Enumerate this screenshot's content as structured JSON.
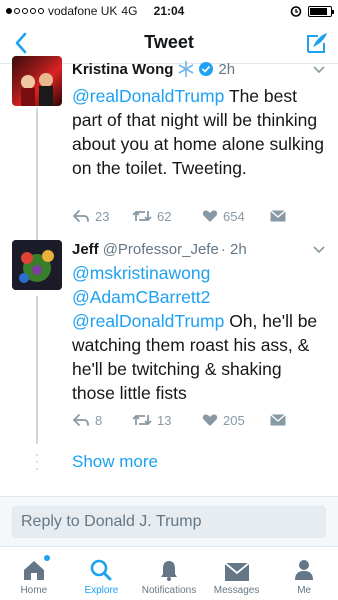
{
  "status_bar": {
    "carrier": "vodafone UK",
    "network": "4G",
    "time": "21:04",
    "battery_level": 0.85
  },
  "nav": {
    "title": "Tweet"
  },
  "tweets": [
    {
      "name": "Kristina Wong",
      "time": "2h",
      "text_parts": [
        {
          "type": "mention",
          "text": "@realDonaldTrump"
        },
        {
          "type": "text",
          "text": " The best part of that night will be thinking about you at home alone sulking on the toilet. Tweeting."
        }
      ],
      "replies": "23",
      "retweets": "62",
      "likes": "654"
    },
    {
      "name": "Jeff",
      "handle": "@Professor_Jefe",
      "time": "· 2h",
      "text_parts": [
        {
          "type": "mention",
          "text": "@mskristinawong"
        },
        {
          "type": "mention",
          "text": "@AdamCBarrett2"
        },
        {
          "type": "mention",
          "text": "@realDonaldTrump"
        },
        {
          "type": "text",
          "text": " Oh, he'll be watching them roast his ass, & he'll be twitching & shaking those little fists"
        }
      ],
      "replies": "8",
      "retweets": "13",
      "likes": "205"
    }
  ],
  "show_more": "Show more",
  "reply_placeholder": "Reply to Donald J. Trump",
  "tabs": [
    {
      "label": "Home",
      "icon": "home-icon"
    },
    {
      "label": "Explore",
      "icon": "search-icon"
    },
    {
      "label": "Notifications",
      "icon": "bell-icon"
    },
    {
      "label": "Messages",
      "icon": "envelope-icon"
    },
    {
      "label": "Me",
      "icon": "person-icon"
    }
  ],
  "colors": {
    "accent": "#1da1f2",
    "muted": "#8899a6"
  }
}
